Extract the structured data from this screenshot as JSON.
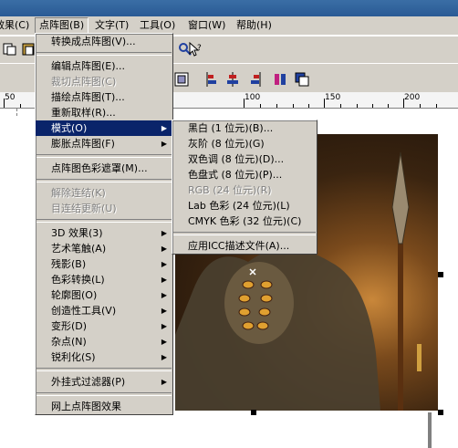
{
  "menubar": {
    "items": [
      {
        "label": "效果(C)"
      },
      {
        "label": "点阵图(B)"
      },
      {
        "label": "文字(T)"
      },
      {
        "label": "工具(O)"
      },
      {
        "label": "窗口(W)"
      },
      {
        "label": "帮助(H)"
      }
    ]
  },
  "ruler": {
    "labels": [
      "50",
      "100",
      "150",
      "200"
    ]
  },
  "bitmap_menu": {
    "items": [
      {
        "label": "转换成点阵图(V)...",
        "type": "item"
      },
      {
        "type": "sep"
      },
      {
        "label": "编辑点阵图(E)...",
        "type": "item"
      },
      {
        "label": "裁切点阵图(C)",
        "type": "disabled"
      },
      {
        "label": "描绘点阵图(T)...",
        "type": "item"
      },
      {
        "label": "重新取样(R)...",
        "type": "item"
      },
      {
        "label": "模式(O)",
        "type": "submenu",
        "highlighted": true
      },
      {
        "label": "膨胀点阵图(F)",
        "type": "submenu"
      },
      {
        "type": "sep"
      },
      {
        "label": "点阵图色彩遮罩(M)...",
        "type": "item"
      },
      {
        "type": "sep"
      },
      {
        "label": "解除连结(K)",
        "type": "disabled"
      },
      {
        "label": "目连结更新(U)",
        "type": "disabled"
      },
      {
        "type": "sep"
      },
      {
        "label": "3D 效果(3)",
        "type": "submenu"
      },
      {
        "label": "艺术笔触(A)",
        "type": "submenu"
      },
      {
        "label": "残影(B)",
        "type": "submenu"
      },
      {
        "label": "色彩转换(L)",
        "type": "submenu"
      },
      {
        "label": "轮廓图(O)",
        "type": "submenu"
      },
      {
        "label": "创造性工具(V)",
        "type": "submenu"
      },
      {
        "label": "变形(D)",
        "type": "submenu"
      },
      {
        "label": "杂点(N)",
        "type": "submenu"
      },
      {
        "label": "锐利化(S)",
        "type": "submenu"
      },
      {
        "type": "sep"
      },
      {
        "label": "外挂式过滤器(P)",
        "type": "submenu"
      },
      {
        "type": "sep"
      },
      {
        "label": "网上点阵图效果",
        "type": "item"
      }
    ]
  },
  "mode_menu": {
    "items": [
      {
        "label": "黑白 (1 位元)(B)...",
        "type": "item"
      },
      {
        "label": "灰阶 (8 位元)(G)",
        "type": "item"
      },
      {
        "label": "双色调 (8 位元)(D)...",
        "type": "item"
      },
      {
        "label": "色盘式 (8 位元)(P)...",
        "type": "item"
      },
      {
        "label": "RGB (24 位元)(R)",
        "type": "disabled"
      },
      {
        "label": "Lab 色彩 (24 位元)(L)",
        "type": "item"
      },
      {
        "label": "CMYK 色彩 (32 位元)(C)",
        "type": "item"
      },
      {
        "type": "sep"
      },
      {
        "label": "应用ICC描述文件(A)...",
        "type": "item"
      }
    ]
  }
}
